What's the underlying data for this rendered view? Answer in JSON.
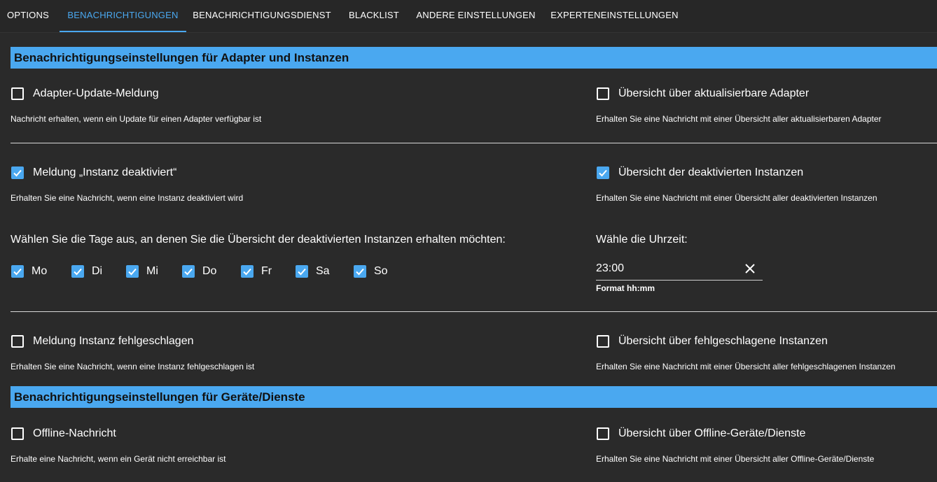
{
  "tabs": [
    {
      "label": "OPTIONS"
    },
    {
      "label": "BENACHRICHTIGUNGEN"
    },
    {
      "label": "BENACHRICHTIGUNGSDIENST"
    },
    {
      "label": "BLACKLIST"
    },
    {
      "label": "ANDERE EINSTELLUNGEN"
    },
    {
      "label": "EXPERTENEINSTELLUNGEN"
    }
  ],
  "active_tab": "BENACHRICHTIGUNGEN",
  "sections": {
    "adapters": {
      "title": "Benachrichtigungseinstellungen für Adapter und Instanzen",
      "update_msg": {
        "label": "Adapter-Update-Meldung",
        "checked": false,
        "help": "Nachricht erhalten, wenn ein Update für einen Adapter verfügbar ist"
      },
      "update_overview": {
        "label": "Übersicht über aktualisierbare Adapter",
        "checked": false,
        "help": "Erhalten Sie eine Nachricht mit einer Übersicht aller aktualisierbaren Adapter"
      },
      "deactivated_msg": {
        "label": "Meldung „Instanz deaktiviert“",
        "checked": true,
        "help": "Erhalten Sie eine Nachricht, wenn eine Instanz deaktiviert wird"
      },
      "deactivated_overview": {
        "label": "Übersicht der deaktivierten Instanzen",
        "checked": true,
        "help": "Erhalten Sie eine Nachricht mit einer Übersicht aller deaktivierten Instanzen"
      },
      "days_prompt": "Wählen Sie die Tage aus, an denen Sie die Übersicht der deaktivierten Instanzen erhalten möchten:",
      "days": [
        {
          "label": "Mo",
          "checked": true
        },
        {
          "label": "Di",
          "checked": true
        },
        {
          "label": "Mi",
          "checked": true
        },
        {
          "label": "Do",
          "checked": true
        },
        {
          "label": "Fr",
          "checked": true
        },
        {
          "label": "Sa",
          "checked": true
        },
        {
          "label": "So",
          "checked": true
        }
      ],
      "time_label": "Wähle die Uhrzeit:",
      "time_value": "23:00",
      "time_format": "Format hh:mm",
      "failed_msg": {
        "label": "Meldung Instanz fehlgeschlagen",
        "checked": false,
        "help": "Erhalten Sie eine Nachricht, wenn eine Instanz fehlgeschlagen ist"
      },
      "failed_overview": {
        "label": "Übersicht über fehlgeschlagene Instanzen",
        "checked": false,
        "help": "Erhalten Sie eine Nachricht mit einer Übersicht aller fehlgeschlagenen Instanzen"
      }
    },
    "devices": {
      "title": "Benachrichtigungseinstellungen für Geräte/Dienste",
      "offline_msg": {
        "label": "Offline-Nachricht",
        "checked": false,
        "help": "Erhalte eine Nachricht, wenn ein Gerät nicht erreichbar ist"
      },
      "offline_overview": {
        "label": "Übersicht über Offline-Geräte/Dienste",
        "checked": false,
        "help": "Erhalten Sie eine Nachricht mit einer Übersicht aller Offline-Geräte/Dienste"
      }
    }
  },
  "colors": {
    "accent": "#4aa8f0",
    "background": "#2a2a2a"
  }
}
